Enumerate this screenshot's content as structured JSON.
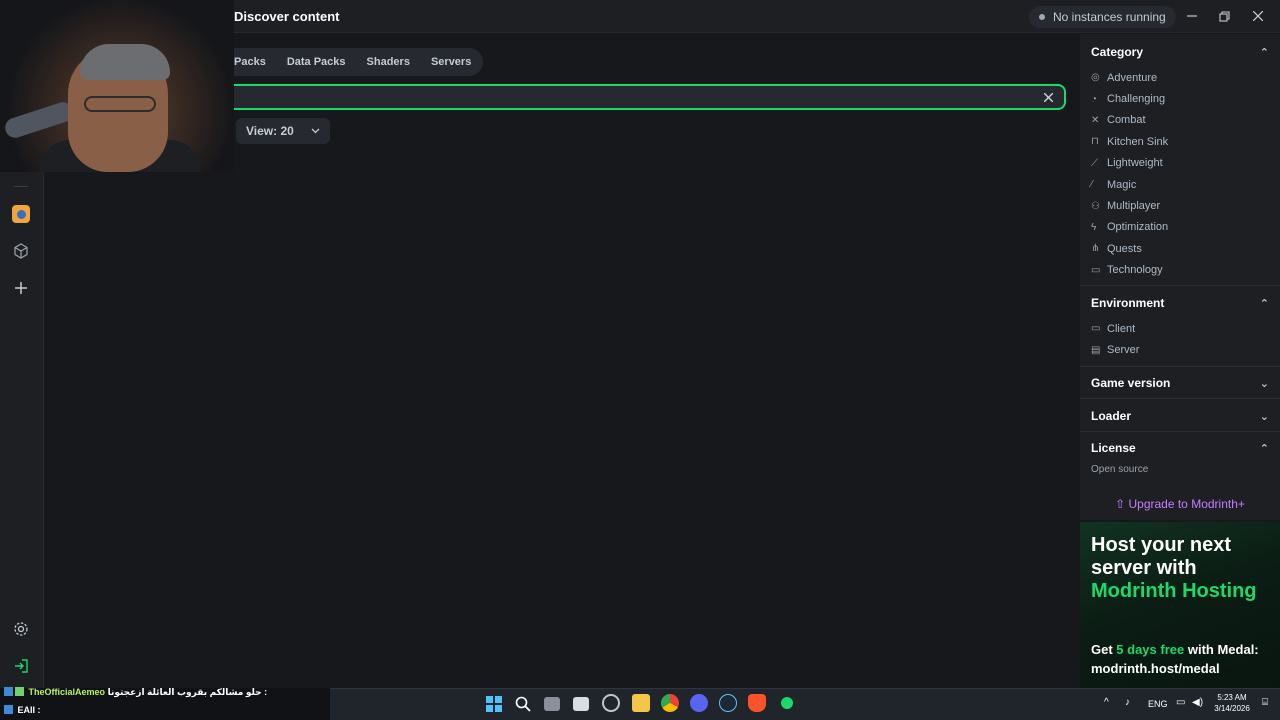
{
  "titlebar": {
    "title": "Discover content",
    "status": "No instances running"
  },
  "tabs": [
    "Packs",
    "Data Packs",
    "Shaders",
    "Servers"
  ],
  "search": {
    "value": "",
    "placeholder": ""
  },
  "view_select": {
    "label": "View: 20"
  },
  "filters": {
    "category": {
      "heading": "Category",
      "items": [
        "Adventure",
        "Challenging",
        "Combat",
        "Kitchen Sink",
        "Lightweight",
        "Magic",
        "Multiplayer",
        "Optimization",
        "Quests",
        "Technology"
      ]
    },
    "environment": {
      "heading": "Environment",
      "items": [
        "Client",
        "Server"
      ]
    },
    "game_version": {
      "heading": "Game version"
    },
    "loader": {
      "heading": "Loader"
    },
    "license": {
      "heading": "License",
      "item": "Open source"
    }
  },
  "upgrade": {
    "label": "Upgrade to Modrinth+"
  },
  "ad": {
    "line1": "Host your next server with",
    "line2": "Modrinth Hosting",
    "sub_pre": "Get",
    "sub_highlight": "5 days free",
    "sub_post": "with Medal:",
    "sub_link": "modrinth.host/medal"
  },
  "chat": {
    "line1_name": "TheOfficialAemeo",
    "line1_text": "حلو مشالكم بقروب العائلة ازعجتونا :",
    "line2_name": "EAII :"
  },
  "taskbar": {
    "lang": "ENG",
    "time": "5:23 AM",
    "date": "3/14/2026"
  },
  "colors": {
    "accent": "#1bd96a",
    "purple": "#c77dff",
    "bg": "#16181c",
    "panel": "#1d1f23"
  },
  "icons": {
    "category": [
      "compass-icon",
      "flag-icon",
      "swords-icon",
      "sink-icon",
      "feather-icon",
      "wand-icon",
      "users-icon",
      "bolt-icon",
      "tree-icon",
      "hard-drive-icon"
    ],
    "environment": [
      "monitor-icon",
      "server-icon"
    ]
  }
}
